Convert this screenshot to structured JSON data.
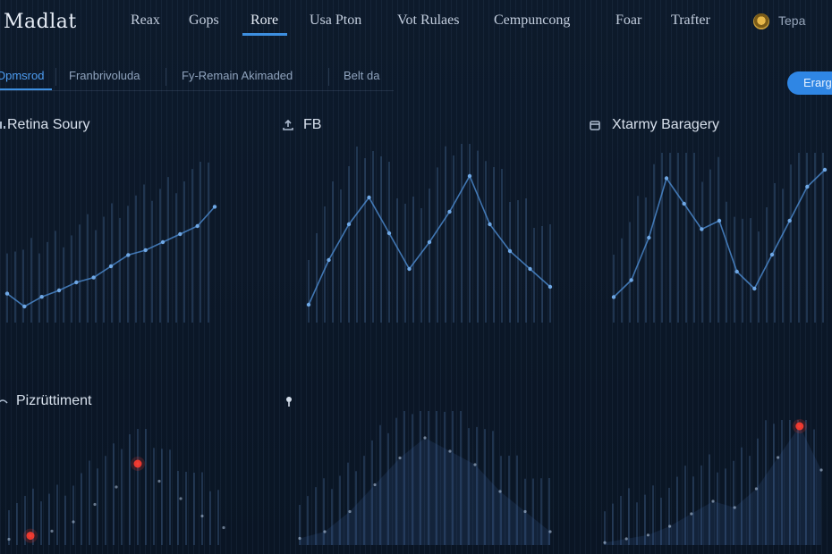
{
  "app": {
    "brand": "Madlat",
    "nav": [
      {
        "label": "Reax"
      },
      {
        "label": "Gops"
      },
      {
        "label": "Rore"
      },
      {
        "label": "Usa Pton"
      },
      {
        "label": "Vot Rulaes"
      },
      {
        "label": "Cempuncong"
      },
      {
        "label": "Foar"
      },
      {
        "label": "Trafter"
      }
    ],
    "active_nav": "Rore",
    "user": {
      "name": "Tepa",
      "avatar_icon": "coin-avatar-icon"
    }
  },
  "subtabs": [
    {
      "label": "Opmsrod"
    },
    {
      "label": "Franbrivoluda"
    },
    {
      "label": "Fy-Remain Akimaded"
    },
    {
      "label": "Belt da"
    }
  ],
  "active_subtab": "Opmsrod",
  "action_button": {
    "label": "Erarg"
  },
  "colors": {
    "accent": "#3d8fe0",
    "background": "#0b1626",
    "line": "#4a86c9",
    "alert": "#ff3b30"
  },
  "panels": [
    {
      "title": "Retina Soury",
      "icon": "chart-icon"
    },
    {
      "title": "FB",
      "icon": "upload-icon"
    },
    {
      "title": "Xtarmy Baragery",
      "icon": "archive-icon"
    },
    {
      "title": "Pizrüttiment",
      "icon": "signal-icon"
    },
    {
      "title": "",
      "icon": "pin-icon"
    },
    {
      "title": "",
      "icon": ""
    }
  ],
  "chart_data": [
    {
      "type": "line",
      "series": [
        {
          "values": [
            0.18,
            0.1,
            0.16,
            0.2,
            0.25,
            0.28,
            0.35,
            0.42,
            0.45,
            0.5,
            0.55,
            0.6,
            0.72
          ]
        }
      ]
    },
    {
      "type": "line",
      "series": [
        {
          "values": [
            0.1,
            0.35,
            0.55,
            0.7,
            0.5,
            0.3,
            0.45,
            0.62,
            0.82,
            0.55,
            0.4,
            0.3,
            0.2
          ]
        }
      ]
    },
    {
      "type": "line",
      "series": [
        {
          "values": [
            0.15,
            0.25,
            0.5,
            0.85,
            0.7,
            0.55,
            0.6,
            0.3,
            0.2,
            0.4,
            0.6,
            0.8,
            0.9
          ]
        }
      ]
    },
    {
      "type": "scatter",
      "series": [
        {
          "values": [
            0.05,
            0.08,
            0.12,
            0.2,
            0.35,
            0.5,
            0.7,
            0.55,
            0.4,
            0.25,
            0.15
          ]
        }
      ],
      "alerts": [
        {
          "index": 6
        },
        {
          "index": 1
        }
      ]
    },
    {
      "type": "area",
      "series": [
        {
          "values": [
            0.05,
            0.1,
            0.25,
            0.45,
            0.65,
            0.8,
            0.7,
            0.6,
            0.4,
            0.25,
            0.1
          ]
        }
      ]
    },
    {
      "type": "area",
      "series": [
        {
          "values": [
            0.02,
            0.05,
            0.08,
            0.15,
            0.25,
            0.35,
            0.3,
            0.45,
            0.7,
            0.95,
            0.6
          ]
        }
      ],
      "alerts": [
        {
          "index": 9
        }
      ]
    }
  ]
}
